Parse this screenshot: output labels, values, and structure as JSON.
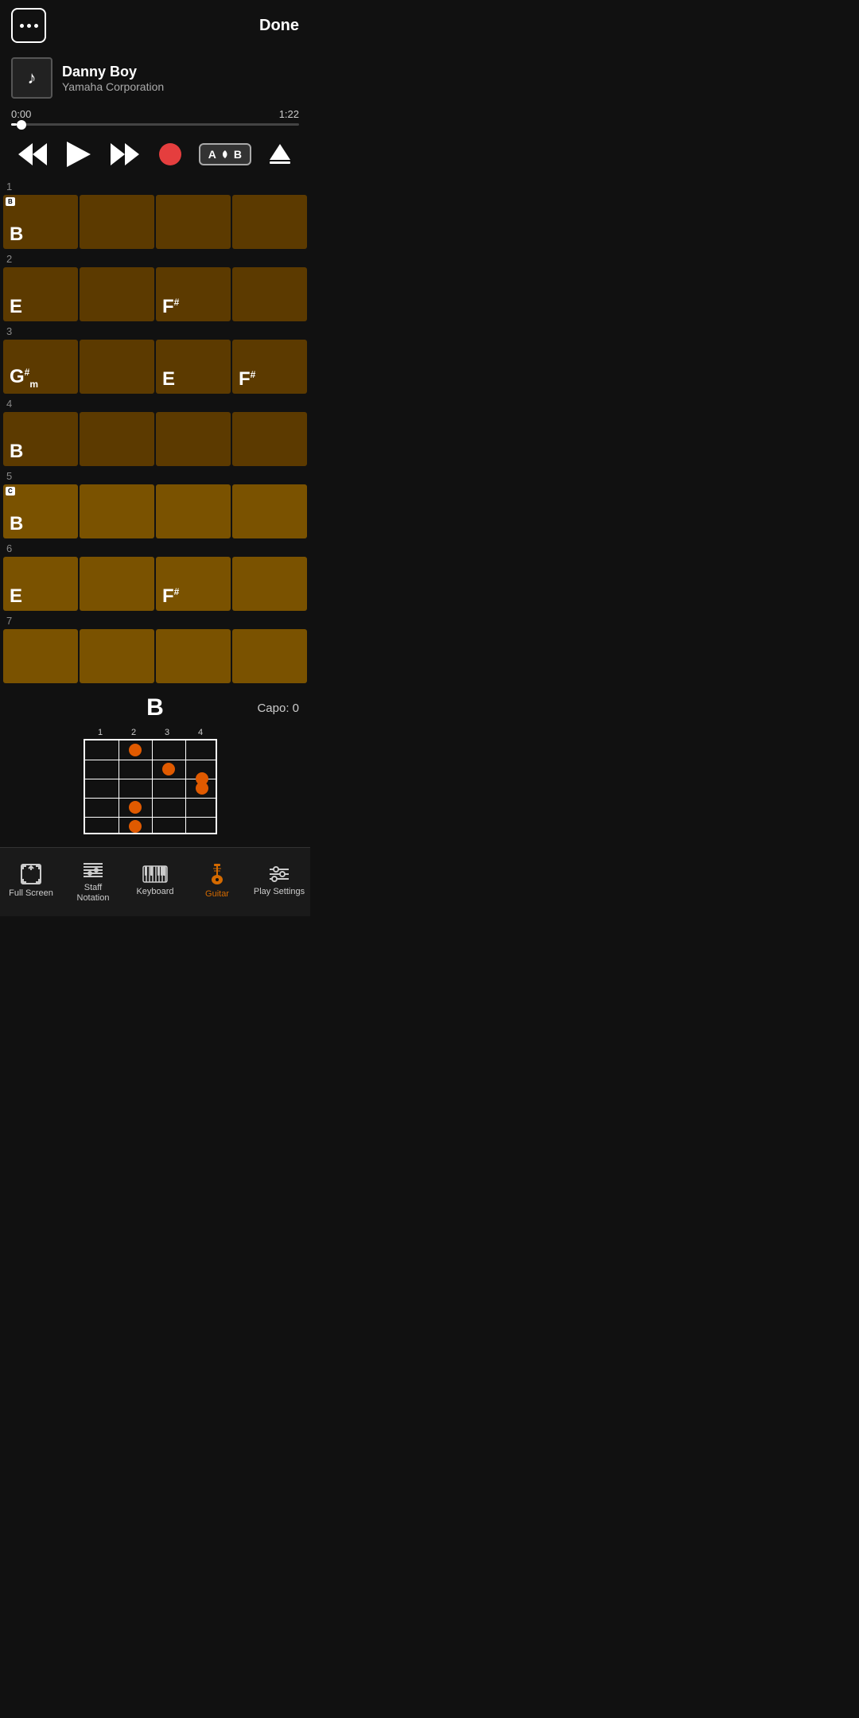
{
  "header": {
    "done_label": "Done"
  },
  "player": {
    "track_title": "Danny Boy",
    "track_artist": "Yamaha Corporation",
    "time_current": "0:00",
    "time_total": "1:22",
    "progress_percent": 2
  },
  "chord_grid": {
    "rows": [
      {
        "number": "1",
        "cells": [
          {
            "label": "B",
            "sup": "",
            "sub": "",
            "capo": "B",
            "light": false
          },
          {
            "label": "",
            "sup": "",
            "sub": "",
            "capo": "",
            "light": false
          },
          {
            "label": "",
            "sup": "",
            "sub": "",
            "capo": "",
            "light": false
          },
          {
            "label": "",
            "sup": "",
            "sub": "",
            "capo": "",
            "light": false
          }
        ]
      },
      {
        "number": "2",
        "cells": [
          {
            "label": "E",
            "sup": "",
            "sub": "",
            "capo": "",
            "light": false
          },
          {
            "label": "",
            "sup": "",
            "sub": "",
            "capo": "",
            "light": false
          },
          {
            "label": "F",
            "sup": "#",
            "sub": "",
            "capo": "",
            "light": false
          },
          {
            "label": "",
            "sup": "",
            "sub": "",
            "capo": "",
            "light": false
          }
        ]
      },
      {
        "number": "3",
        "cells": [
          {
            "label": "G",
            "sup": "#",
            "sub": "m",
            "capo": "",
            "light": false
          },
          {
            "label": "",
            "sup": "",
            "sub": "",
            "capo": "",
            "light": false
          },
          {
            "label": "E",
            "sup": "",
            "sub": "",
            "capo": "",
            "light": false
          },
          {
            "label": "F",
            "sup": "#",
            "sub": "",
            "capo": "",
            "light": false
          }
        ]
      },
      {
        "number": "4",
        "cells": [
          {
            "label": "B",
            "sup": "",
            "sub": "",
            "capo": "",
            "light": false
          },
          {
            "label": "",
            "sup": "",
            "sub": "",
            "capo": "",
            "light": false
          },
          {
            "label": "",
            "sup": "",
            "sub": "",
            "capo": "",
            "light": false
          },
          {
            "label": "",
            "sup": "",
            "sub": "",
            "capo": "",
            "light": false
          }
        ]
      },
      {
        "number": "5",
        "cells": [
          {
            "label": "B",
            "sup": "",
            "sub": "",
            "capo": "C",
            "light": true
          },
          {
            "label": "",
            "sup": "",
            "sub": "",
            "capo": "",
            "light": true
          },
          {
            "label": "",
            "sup": "",
            "sub": "",
            "capo": "",
            "light": true
          },
          {
            "label": "",
            "sup": "",
            "sub": "",
            "capo": "",
            "light": true
          }
        ]
      },
      {
        "number": "6",
        "cells": [
          {
            "label": "E",
            "sup": "",
            "sub": "",
            "capo": "",
            "light": true
          },
          {
            "label": "",
            "sup": "",
            "sub": "",
            "capo": "",
            "light": true
          },
          {
            "label": "F",
            "sup": "#",
            "sub": "",
            "capo": "",
            "light": true
          },
          {
            "label": "",
            "sup": "",
            "sub": "",
            "capo": "",
            "light": true
          }
        ]
      },
      {
        "number": "7",
        "cells": [
          {
            "label": "",
            "sup": "",
            "sub": "",
            "capo": "",
            "light": true
          },
          {
            "label": "",
            "sup": "",
            "sub": "",
            "capo": "",
            "light": true
          },
          {
            "label": "",
            "sup": "",
            "sub": "",
            "capo": "",
            "light": true
          },
          {
            "label": "",
            "sup": "",
            "sub": "",
            "capo": "",
            "light": true
          }
        ]
      }
    ]
  },
  "chord_diagram": {
    "chord_name": "B",
    "capo_label": "Capo: 0",
    "fret_numbers": [
      "1",
      "2",
      "3",
      "4"
    ]
  },
  "bottom_nav": {
    "items": [
      {
        "id": "fullscreen",
        "label": "Full Screen",
        "active": false
      },
      {
        "id": "staff",
        "label": "Staff\nNotation",
        "active": false
      },
      {
        "id": "keyboard",
        "label": "Keyboard",
        "active": false
      },
      {
        "id": "guitar",
        "label": "Guitar",
        "active": true
      },
      {
        "id": "playsettings",
        "label": "Play Settings",
        "active": false
      }
    ]
  }
}
